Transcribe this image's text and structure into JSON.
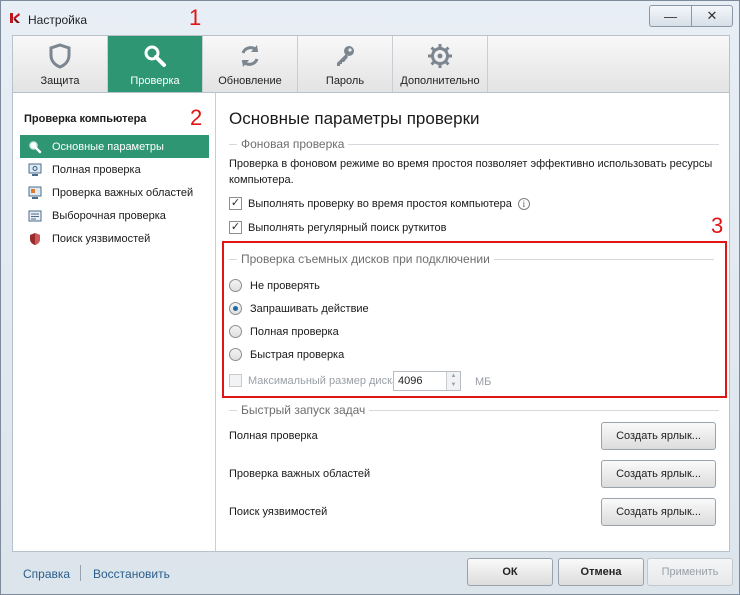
{
  "window": {
    "title": "Настройка",
    "minimize_glyph": "—",
    "close_glyph": "✕"
  },
  "annotations": [
    "1",
    "2",
    "3"
  ],
  "toolbar": {
    "tabs": [
      {
        "label": "Защита",
        "icon": "shield-icon"
      },
      {
        "label": "Проверка",
        "icon": "magnifier-icon",
        "active": true
      },
      {
        "label": "Обновление",
        "icon": "refresh-icon"
      },
      {
        "label": "Пароль",
        "icon": "key-icon"
      },
      {
        "label": "Дополнительно",
        "icon": "gear-icon"
      }
    ]
  },
  "sidebar": {
    "heading": "Проверка компьютера",
    "items": [
      {
        "label": "Основные параметры",
        "icon": "magnifier-icon",
        "active": true
      },
      {
        "label": "Полная проверка",
        "icon": "monitor-scan-icon"
      },
      {
        "label": "Проверка важных областей",
        "icon": "important-areas-icon"
      },
      {
        "label": "Выборочная проверка",
        "icon": "custom-scan-icon"
      },
      {
        "label": "Поиск уязвимостей",
        "icon": "vulnerability-shield-icon"
      }
    ]
  },
  "main": {
    "title": "Основные параметры проверки",
    "background_scan": {
      "caption": "Фоновая проверка",
      "description": "Проверка в фоновом режиме во время простоя позволяет эффективно использовать ресурсы компьютера.",
      "options": [
        {
          "label": "Выполнять проверку во время простоя компьютера",
          "checked": true
        },
        {
          "label": "Выполнять регулярный поиск руткитов",
          "checked": true
        }
      ]
    },
    "removable": {
      "caption": "Проверка съемных дисков при подключении",
      "options": [
        {
          "label": "Не проверять",
          "checked": false
        },
        {
          "label": "Запрашивать действие",
          "checked": true
        },
        {
          "label": "Полная проверка",
          "checked": false
        },
        {
          "label": "Быстрая проверка",
          "checked": false
        }
      ],
      "max_size_label": "Максимальный размер диска:",
      "max_size_value": "4096",
      "unit": "МБ"
    },
    "quick_tasks": {
      "caption": "Быстрый запуск задач",
      "tasks": [
        {
          "label": "Полная проверка",
          "button": "Создать ярлык..."
        },
        {
          "label": "Проверка важных областей",
          "button": "Создать ярлык..."
        },
        {
          "label": "Поиск уязвимостей",
          "button": "Создать ярлык..."
        }
      ]
    }
  },
  "footer": {
    "help": "Справка",
    "restore": "Восстановить",
    "ok": "ОК",
    "cancel": "Отмена",
    "apply": "Применить"
  },
  "colors": {
    "accent": "#2e9673",
    "annotation": "#e01515"
  }
}
